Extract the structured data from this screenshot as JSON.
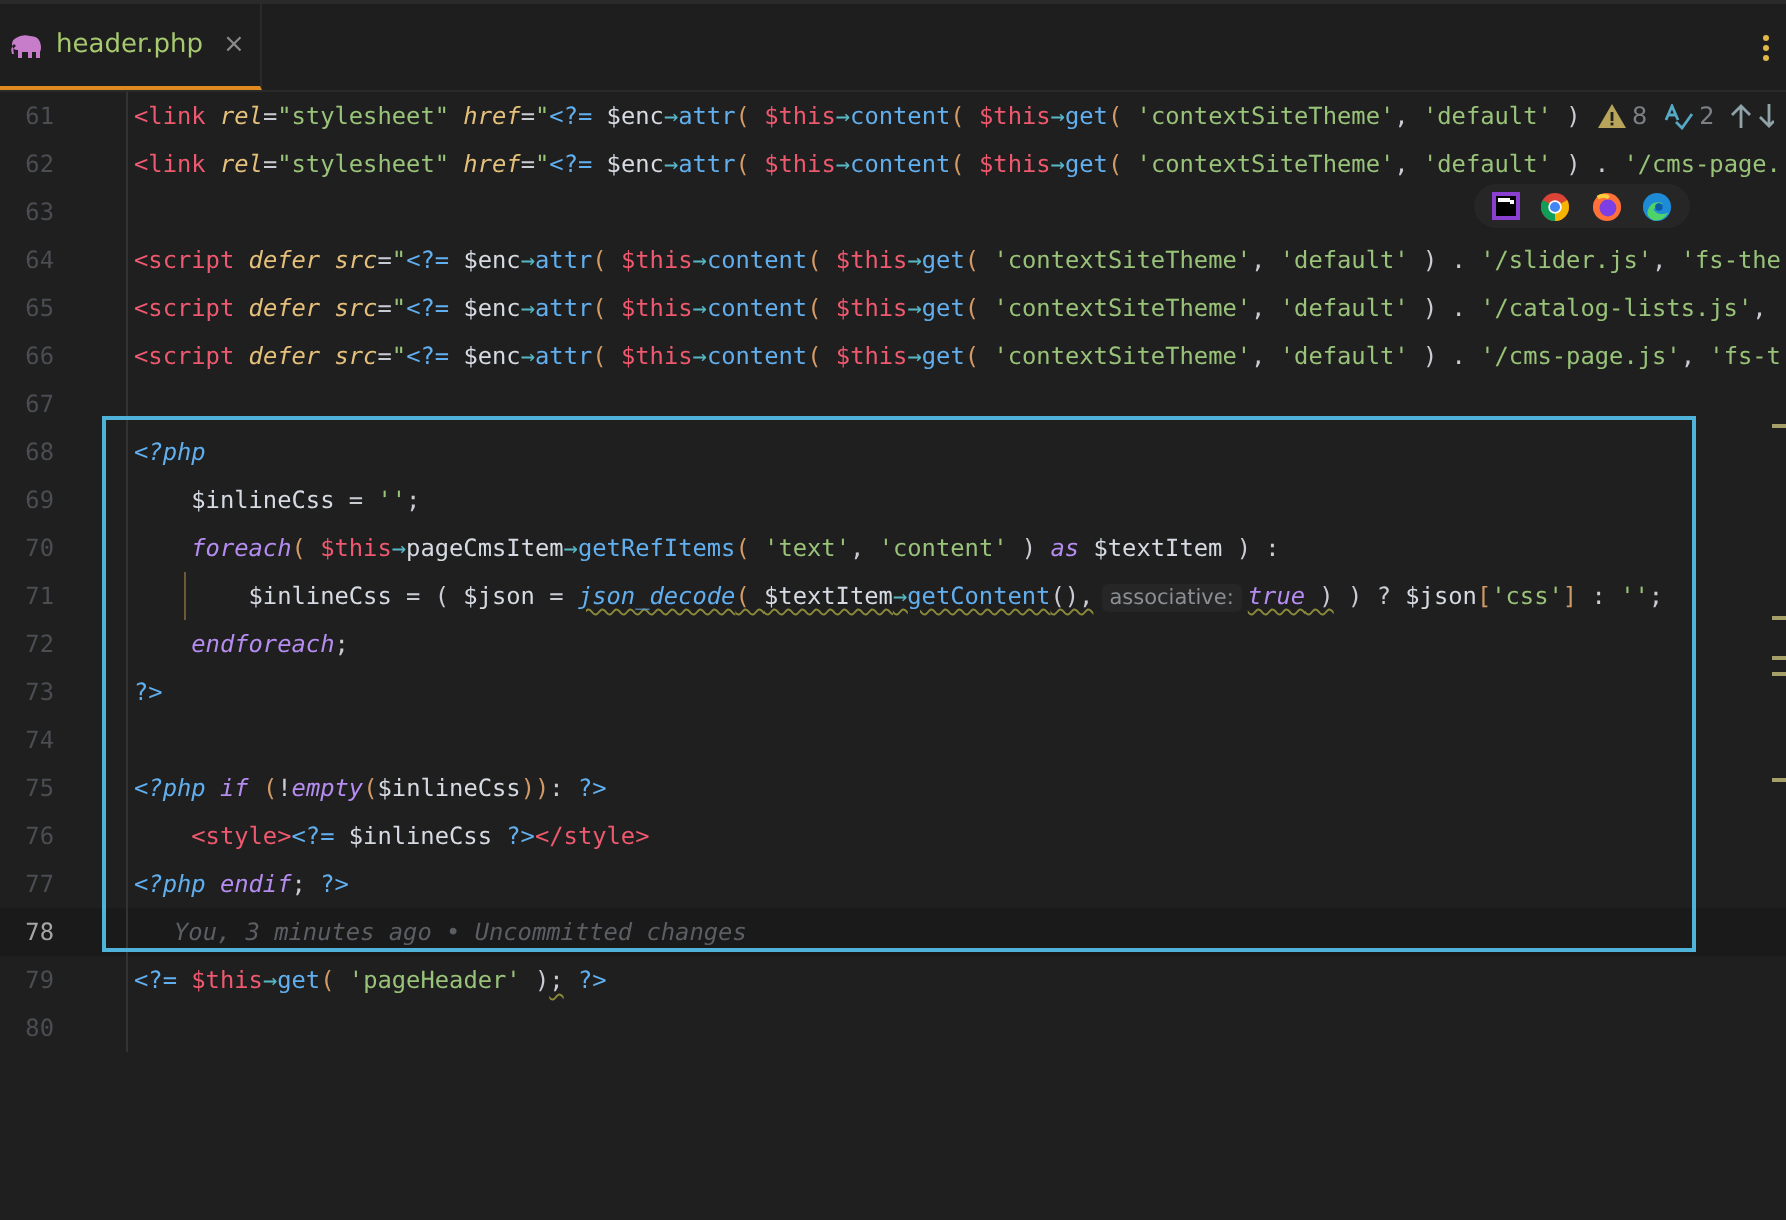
{
  "tabs": [
    {
      "label": "header.php",
      "close": "×",
      "selected": true
    }
  ],
  "inspection": {
    "warnings": "8",
    "typos": "2"
  },
  "lines": [
    {
      "number": "61",
      "current": false,
      "tokens": [
        {
          "kind": "tag",
          "text": "<link"
        },
        {
          "kind": "attr",
          "text": " rel"
        },
        {
          "kind": "plain",
          "text": "="
        },
        {
          "kind": "string",
          "text": "\"stylesheet\""
        },
        {
          "kind": "attr",
          "text": " href"
        },
        {
          "kind": "plain",
          "text": "="
        },
        {
          "kind": "string",
          "text": "\""
        },
        {
          "kind": "php",
          "text": "<?="
        },
        {
          "kind": "var",
          "text": " $enc"
        },
        {
          "kind": "arrow",
          "text": "→"
        },
        {
          "kind": "method",
          "text": "attr"
        },
        {
          "kind": "paren",
          "text": "( "
        },
        {
          "kind": "this",
          "text": "$this"
        },
        {
          "kind": "arrow",
          "text": "→"
        },
        {
          "kind": "method",
          "text": "content"
        },
        {
          "kind": "paren",
          "text": "( "
        },
        {
          "kind": "this",
          "text": "$this"
        },
        {
          "kind": "arrow",
          "text": "→"
        },
        {
          "kind": "method",
          "text": "get"
        },
        {
          "kind": "paren",
          "text": "( "
        },
        {
          "kind": "string",
          "text": "'contextSiteTheme'"
        },
        {
          "kind": "plain",
          "text": ", "
        },
        {
          "kind": "string",
          "text": "'default'"
        },
        {
          "kind": "plain",
          "text": " )"
        }
      ]
    },
    {
      "number": "62",
      "current": false,
      "tokens": [
        {
          "kind": "tag",
          "text": "<link"
        },
        {
          "kind": "attr",
          "text": " rel"
        },
        {
          "kind": "plain",
          "text": "="
        },
        {
          "kind": "string",
          "text": "\"stylesheet\""
        },
        {
          "kind": "attr",
          "text": " href"
        },
        {
          "kind": "plain",
          "text": "="
        },
        {
          "kind": "string",
          "text": "\""
        },
        {
          "kind": "php",
          "text": "<?="
        },
        {
          "kind": "var",
          "text": " $enc"
        },
        {
          "kind": "arrow",
          "text": "→"
        },
        {
          "kind": "method",
          "text": "attr"
        },
        {
          "kind": "paren",
          "text": "( "
        },
        {
          "kind": "this",
          "text": "$this"
        },
        {
          "kind": "arrow",
          "text": "→"
        },
        {
          "kind": "method",
          "text": "content"
        },
        {
          "kind": "paren",
          "text": "( "
        },
        {
          "kind": "this",
          "text": "$this"
        },
        {
          "kind": "arrow",
          "text": "→"
        },
        {
          "kind": "method",
          "text": "get"
        },
        {
          "kind": "paren",
          "text": "( "
        },
        {
          "kind": "string",
          "text": "'contextSiteTheme'"
        },
        {
          "kind": "plain",
          "text": ", "
        },
        {
          "kind": "string",
          "text": "'default'"
        },
        {
          "kind": "plain",
          "text": " ) . "
        },
        {
          "kind": "string",
          "text": "'/cms-page."
        }
      ]
    },
    {
      "number": "63",
      "current": false
    },
    {
      "number": "64",
      "current": false,
      "tokens": [
        {
          "kind": "tag",
          "text": "<script"
        },
        {
          "kind": "attr",
          "text": " defer"
        },
        {
          "kind": "attr",
          "text": " src"
        },
        {
          "kind": "plain",
          "text": "="
        },
        {
          "kind": "string",
          "text": "\""
        },
        {
          "kind": "php",
          "text": "<?="
        },
        {
          "kind": "var",
          "text": " $enc"
        },
        {
          "kind": "arrow",
          "text": "→"
        },
        {
          "kind": "method",
          "text": "attr"
        },
        {
          "kind": "paren",
          "text": "( "
        },
        {
          "kind": "this",
          "text": "$this"
        },
        {
          "kind": "arrow",
          "text": "→"
        },
        {
          "kind": "method",
          "text": "content"
        },
        {
          "kind": "paren",
          "text": "( "
        },
        {
          "kind": "this",
          "text": "$this"
        },
        {
          "kind": "arrow",
          "text": "→"
        },
        {
          "kind": "method",
          "text": "get"
        },
        {
          "kind": "paren",
          "text": "( "
        },
        {
          "kind": "string",
          "text": "'contextSiteTheme'"
        },
        {
          "kind": "plain",
          "text": ", "
        },
        {
          "kind": "string",
          "text": "'default'"
        },
        {
          "kind": "plain",
          "text": " ) . "
        },
        {
          "kind": "string",
          "text": "'/slider.js'"
        },
        {
          "kind": "plain",
          "text": ", "
        },
        {
          "kind": "string",
          "text": "'fs-the"
        }
      ]
    },
    {
      "number": "65",
      "current": false,
      "tokens": [
        {
          "kind": "tag",
          "text": "<script"
        },
        {
          "kind": "attr",
          "text": " defer"
        },
        {
          "kind": "attr",
          "text": " src"
        },
        {
          "kind": "plain",
          "text": "="
        },
        {
          "kind": "string",
          "text": "\""
        },
        {
          "kind": "php",
          "text": "<?="
        },
        {
          "kind": "var",
          "text": " $enc"
        },
        {
          "kind": "arrow",
          "text": "→"
        },
        {
          "kind": "method",
          "text": "attr"
        },
        {
          "kind": "paren",
          "text": "( "
        },
        {
          "kind": "this",
          "text": "$this"
        },
        {
          "kind": "arrow",
          "text": "→"
        },
        {
          "kind": "method",
          "text": "content"
        },
        {
          "kind": "paren",
          "text": "( "
        },
        {
          "kind": "this",
          "text": "$this"
        },
        {
          "kind": "arrow",
          "text": "→"
        },
        {
          "kind": "method",
          "text": "get"
        },
        {
          "kind": "paren",
          "text": "( "
        },
        {
          "kind": "string",
          "text": "'contextSiteTheme'"
        },
        {
          "kind": "plain",
          "text": ", "
        },
        {
          "kind": "string",
          "text": "'default'"
        },
        {
          "kind": "plain",
          "text": " ) . "
        },
        {
          "kind": "string",
          "text": "'/catalog-lists.js'"
        },
        {
          "kind": "plain",
          "text": ","
        }
      ]
    },
    {
      "number": "66",
      "current": false,
      "tokens": [
        {
          "kind": "tag",
          "text": "<script"
        },
        {
          "kind": "attr",
          "text": " defer"
        },
        {
          "kind": "attr",
          "text": " src"
        },
        {
          "kind": "plain",
          "text": "="
        },
        {
          "kind": "string",
          "text": "\""
        },
        {
          "kind": "php",
          "text": "<?="
        },
        {
          "kind": "var",
          "text": " $enc"
        },
        {
          "kind": "arrow",
          "text": "→"
        },
        {
          "kind": "method",
          "text": "attr"
        },
        {
          "kind": "paren",
          "text": "( "
        },
        {
          "kind": "this",
          "text": "$this"
        },
        {
          "kind": "arrow",
          "text": "→"
        },
        {
          "kind": "method",
          "text": "content"
        },
        {
          "kind": "paren",
          "text": "( "
        },
        {
          "kind": "this",
          "text": "$this"
        },
        {
          "kind": "arrow",
          "text": "→"
        },
        {
          "kind": "method",
          "text": "get"
        },
        {
          "kind": "paren",
          "text": "( "
        },
        {
          "kind": "string",
          "text": "'contextSiteTheme'"
        },
        {
          "kind": "plain",
          "text": ", "
        },
        {
          "kind": "string",
          "text": "'default'"
        },
        {
          "kind": "plain",
          "text": " ) . "
        },
        {
          "kind": "string",
          "text": "'/cms-page.js'"
        },
        {
          "kind": "plain",
          "text": ", "
        },
        {
          "kind": "string",
          "text": "'fs-t"
        }
      ]
    },
    {
      "number": "67",
      "current": false
    },
    {
      "number": "68",
      "current": false,
      "tokens": [
        {
          "kind": "phpopen",
          "text": "<?php"
        }
      ]
    },
    {
      "number": "69",
      "current": false,
      "tokens": [
        {
          "kind": "var",
          "text": "    $inlineCss"
        },
        {
          "kind": "plain",
          "text": " = "
        },
        {
          "kind": "string",
          "text": "''"
        },
        {
          "kind": "plain",
          "text": ";"
        }
      ]
    },
    {
      "number": "70",
      "current": false,
      "tokens": [
        {
          "kind": "keyword",
          "text": "    foreach"
        },
        {
          "kind": "paren",
          "text": "( "
        },
        {
          "kind": "this",
          "text": "$this"
        },
        {
          "kind": "arrow",
          "text": "→"
        },
        {
          "kind": "prop",
          "text": "pageCmsItem"
        },
        {
          "kind": "arrow",
          "text": "→"
        },
        {
          "kind": "method",
          "text": "getRefItems"
        },
        {
          "kind": "paren",
          "text": "( "
        },
        {
          "kind": "string",
          "text": "'text'"
        },
        {
          "kind": "plain",
          "text": ", "
        },
        {
          "kind": "string",
          "text": "'content'"
        },
        {
          "kind": "plain",
          "text": " ) "
        },
        {
          "kind": "keyword",
          "text": "as"
        },
        {
          "kind": "var",
          "text": " $textItem"
        },
        {
          "kind": "plain",
          "text": " ) :"
        }
      ]
    },
    {
      "number": "71",
      "current": false,
      "guide": true,
      "tokens": [
        {
          "kind": "var",
          "text": "        $inlineCss",
          "squiggle": false
        },
        {
          "kind": "plain",
          "text": " = ( ",
          "squiggle": false
        },
        {
          "kind": "var",
          "text": "$json",
          "squiggle": false
        },
        {
          "kind": "plain",
          "text": " = ",
          "squiggle": false
        },
        {
          "kind": "fn",
          "text": "json_decode",
          "squiggle": true
        },
        {
          "kind": "paren",
          "text": "( ",
          "squiggle": true
        },
        {
          "kind": "var",
          "text": "$textItem",
          "squiggle": true
        },
        {
          "kind": "arrow",
          "text": "→",
          "squiggle": true
        },
        {
          "kind": "method",
          "text": "getContent",
          "squiggle": true
        },
        {
          "kind": "plain",
          "text": "(),",
          "squiggle": true
        },
        {
          "kind": "hint",
          "text": "associative:",
          "squiggle": false
        },
        {
          "kind": "keyword",
          "text": "true",
          "squiggle": true
        },
        {
          "kind": "plain",
          "text": " )",
          "squiggle": true
        },
        {
          "kind": "plain",
          "text": " ) ? ",
          "squiggle": false
        },
        {
          "kind": "var",
          "text": "$json",
          "squiggle": false
        },
        {
          "kind": "paren",
          "text": "[",
          "squiggle": false
        },
        {
          "kind": "string",
          "text": "'css'",
          "squiggle": false
        },
        {
          "kind": "paren",
          "text": "]",
          "squiggle": false
        },
        {
          "kind": "plain",
          "text": " : ",
          "squiggle": false
        },
        {
          "kind": "string",
          "text": "''",
          "squiggle": false
        },
        {
          "kind": "plain",
          "text": ";",
          "squiggle": false
        }
      ]
    },
    {
      "number": "72",
      "current": false,
      "tokens": [
        {
          "kind": "keyword",
          "text": "    endforeach"
        },
        {
          "kind": "plain",
          "text": ";"
        }
      ]
    },
    {
      "number": "73",
      "current": false,
      "tokens": [
        {
          "kind": "php",
          "text": "?>"
        }
      ]
    },
    {
      "number": "74",
      "current": false
    },
    {
      "number": "75",
      "current": false,
      "tokens": [
        {
          "kind": "phpopen",
          "text": "<?php"
        },
        {
          "kind": "keyword",
          "text": " if"
        },
        {
          "kind": "paren",
          "text": " ("
        },
        {
          "kind": "plain",
          "text": "!"
        },
        {
          "kind": "keyword",
          "text": "empty"
        },
        {
          "kind": "paren",
          "text": "("
        },
        {
          "kind": "var",
          "text": "$inlineCss"
        },
        {
          "kind": "paren",
          "text": "))"
        },
        {
          "kind": "plain",
          "text": ": "
        },
        {
          "kind": "php",
          "text": "?>"
        }
      ]
    },
    {
      "number": "76",
      "current": false,
      "tokens": [
        {
          "kind": "tag",
          "text": "    <style>"
        },
        {
          "kind": "php",
          "text": "<?="
        },
        {
          "kind": "var",
          "text": " $inlineCss "
        },
        {
          "kind": "php",
          "text": "?>"
        },
        {
          "kind": "tag",
          "text": "</style>"
        }
      ]
    },
    {
      "number": "77",
      "current": false,
      "tokens": [
        {
          "kind": "phpopen",
          "text": "<?php"
        },
        {
          "kind": "keyword",
          "text": " endif"
        },
        {
          "kind": "plain",
          "text": "; "
        },
        {
          "kind": "php",
          "text": "?>"
        }
      ]
    },
    {
      "number": "78",
      "current": true,
      "blame": "You, 3 minutes ago • Uncommitted changes"
    },
    {
      "number": "79",
      "current": false,
      "tokens": [
        {
          "kind": "php",
          "text": "<?=",
          "squiggle": false
        },
        {
          "kind": "this",
          "text": " $this",
          "squiggle": false
        },
        {
          "kind": "arrow",
          "text": "→",
          "squiggle": false
        },
        {
          "kind": "method",
          "text": "get",
          "squiggle": false
        },
        {
          "kind": "paren",
          "text": "( ",
          "squiggle": false
        },
        {
          "kind": "string",
          "text": "'pageHeader'",
          "squiggle": false
        },
        {
          "kind": "plain",
          "text": " )",
          "squiggle": false
        },
        {
          "kind": "plain",
          "text": ";",
          "squiggle": true
        },
        {
          "kind": "php",
          "text": " ?>",
          "squiggle": false
        }
      ]
    },
    {
      "number": "80",
      "current": false
    }
  ]
}
